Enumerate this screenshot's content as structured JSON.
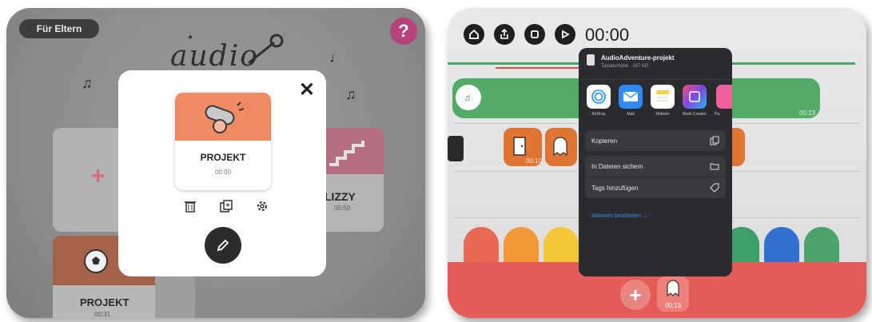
{
  "left": {
    "parents_button": "Für Eltern",
    "help_button": "?",
    "logo_text": "audio",
    "music_notes": [
      "♫",
      "♩",
      "♫",
      "♫"
    ],
    "new_card_plus": "+",
    "lizzy_card": {
      "name": "LIZZY",
      "time": "00:50"
    },
    "bottom_card": {
      "name": "PROJEKT",
      "time": "00:31"
    },
    "modal": {
      "close": "✕",
      "project_name": "PROJEKT",
      "project_time": "00:00"
    }
  },
  "right": {
    "timer": "00:00",
    "green_track_time": "00:23",
    "note_icon": "♬",
    "clip_time": "00:10",
    "add_button": "+",
    "ghost_time": "00:13",
    "share_sheet": {
      "file_title": "AudioAdventure-projekt",
      "file_subtitle": "Tastaturhülle · 167 KB",
      "apps": [
        {
          "label": "AirDrop",
          "color": "#1d8ef5"
        },
        {
          "label": "Mail",
          "color": "#2f8af5"
        },
        {
          "label": "Notizen",
          "color": "#f6d34a"
        },
        {
          "label": "Book Creator",
          "color": "#7a4ae0"
        },
        {
          "label": "Pa",
          "color": "#f0609a"
        }
      ],
      "copy": "Kopieren",
      "save_files": "In Dateien sichern",
      "add_tags": "Tags hinzufügen",
      "edit_actions": "Aktionen bearbeiten ..."
    },
    "palette_colors": [
      "#e86a56",
      "#f09a3a",
      "#f3c73a",
      "#4e8fe0",
      "#3e9e68",
      "#2f6fd0",
      "#4aa56c"
    ]
  }
}
